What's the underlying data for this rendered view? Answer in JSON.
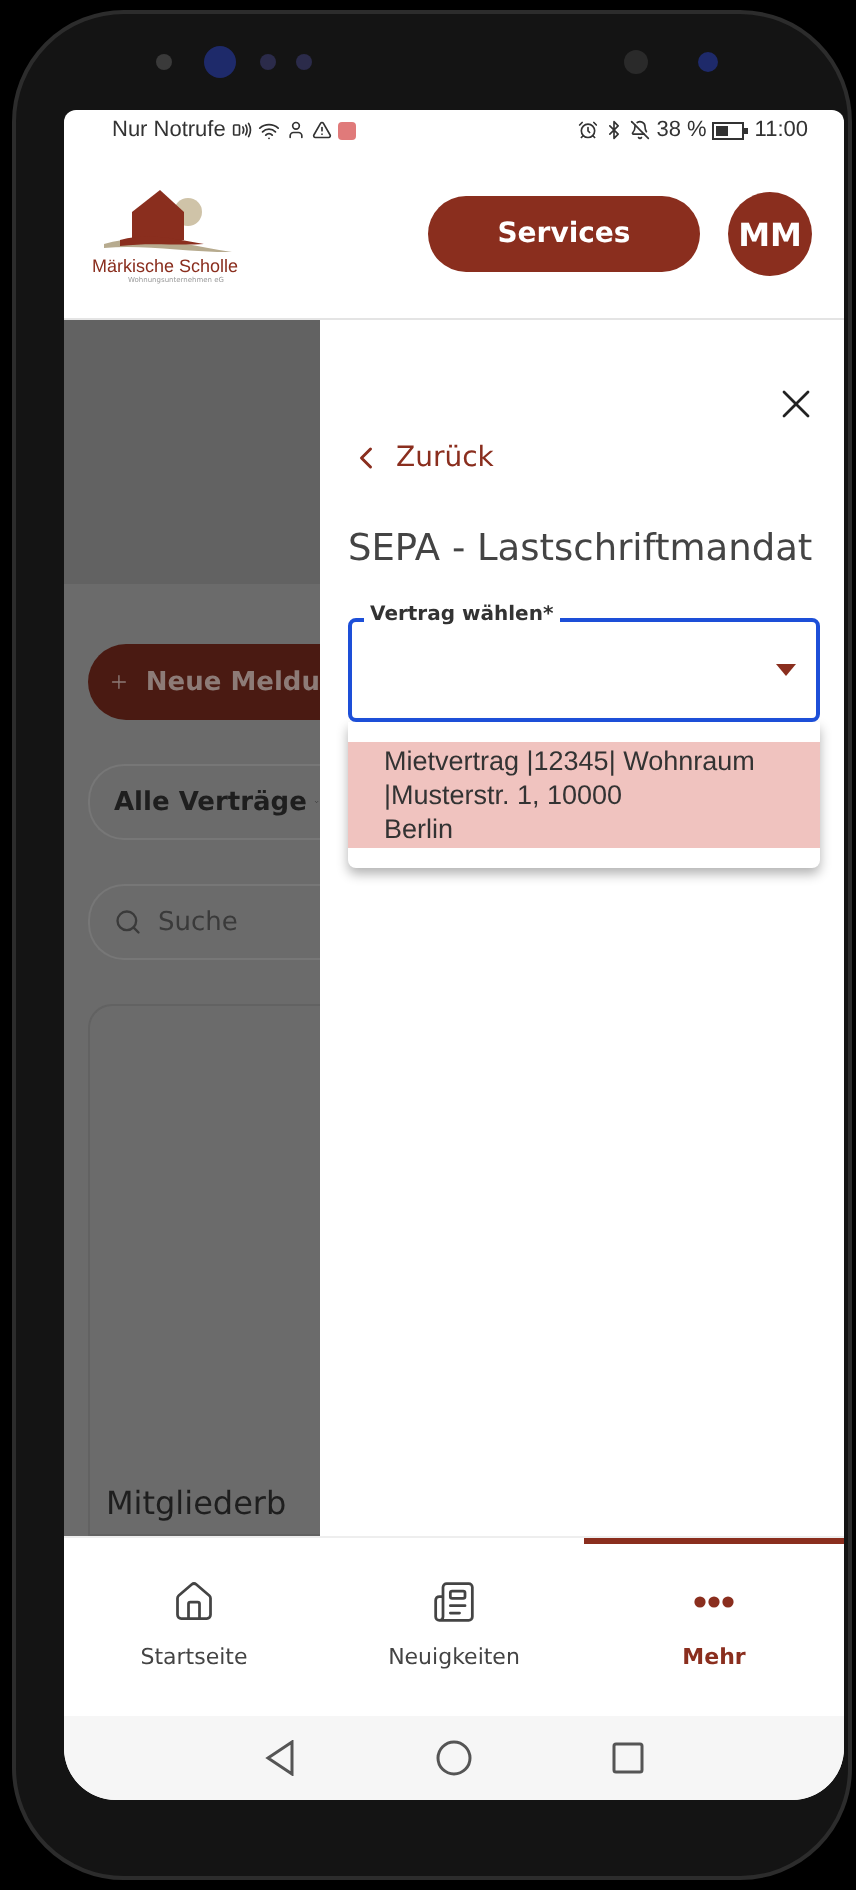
{
  "status_bar": {
    "carrier": "Nur Notrufe",
    "battery": "38 %",
    "time": "11:00"
  },
  "header": {
    "logo_name": "Märkische Scholle",
    "logo_tagline": "Wohnungsunternehmen eG",
    "services_button": "Services",
    "avatar": "MM"
  },
  "background_page": {
    "new_report_button": "Neue Meldu",
    "filter": "Alle Verträge",
    "search_placeholder": "Suche",
    "card_title": "Mitgliederb"
  },
  "drawer": {
    "back": "Zurück",
    "title": "SEPA - Lastschriftmandat",
    "select": {
      "label": "Vertrag wählen",
      "required_mark": "*",
      "focused": true,
      "options": [
        {
          "lines": [
            "Mietvertrag |12345| Wohnraum",
            "|Musterstr. 1, 10000",
            "Berlin"
          ],
          "selected": true
        }
      ]
    }
  },
  "bottom_nav": [
    {
      "label": "Startseite",
      "kind": "home",
      "selected": false
    },
    {
      "label": "Neuigkeiten",
      "kind": "news",
      "selected": false
    },
    {
      "label": "Mehr",
      "kind": "more",
      "selected": true
    }
  ]
}
